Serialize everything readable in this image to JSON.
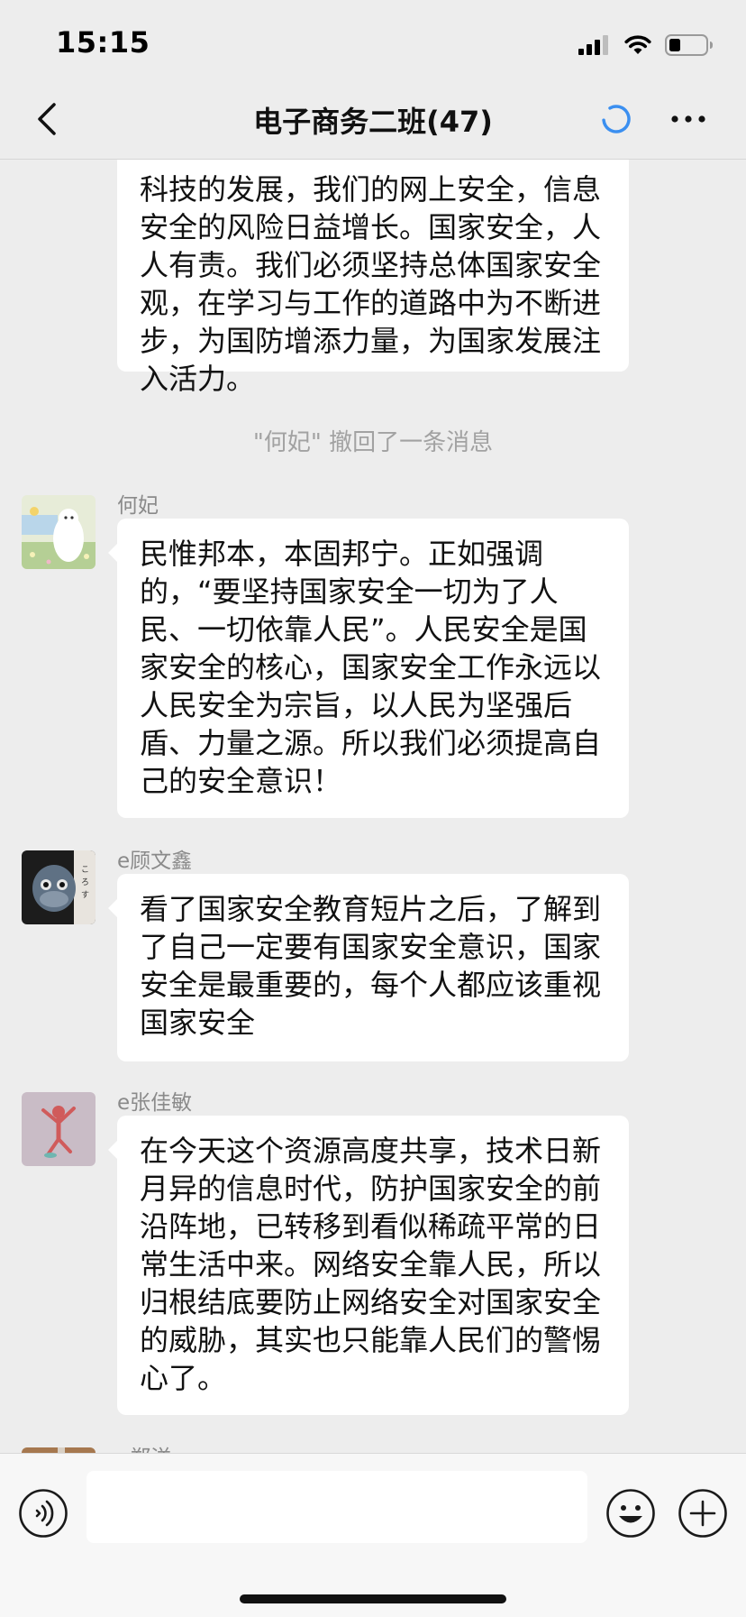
{
  "status_bar": {
    "time": "15:15"
  },
  "nav": {
    "title": "电子商务二班(47)"
  },
  "messages": [
    {
      "text": "科技的发展，我们的网上安全，信息安全的风险日益增长。国家安全，人人有责。我们必须坚持总体国家安全观，在学习与工作的道路中为不断进步，为国防增添力量，为国家发展注入活力。"
    },
    {
      "sender": "何妃",
      "text": "民惟邦本，本固邦宁。正如强调的，“要坚持国家安全一切为了人民、一切依靠人民”。人民安全是国家安全的核心，国家安全工作永远以人民安全为宗旨，以人民为坚强后盾、力量之源。所以我们必须提高自己的安全意识！"
    },
    {
      "sender": "e顾文鑫",
      "text": "看了国家安全教育短片之后，了解到了自己一定要有国家安全意识，国家安全是最重要的，每个人都应该重视国家安全"
    },
    {
      "sender": "e张佳敏",
      "text": "在今天这个资源高度共享，技术日新月异的信息时代，防护国家安全的前沿阵地，已转移到看似稀疏平常的日常生活中来。网络安全靠人民，所以归根结底要防止网络安全对国家安全的威胁，其实也只能靠人民们的警惕心了。"
    },
    {
      "sender": "e郑洋"
    }
  ],
  "system": {
    "recall_notice": "\"何妃\" 撤回了一条消息"
  },
  "input": {
    "value": ""
  },
  "colors": {
    "background": "#ededed",
    "bubble": "#ffffff",
    "accent_loading": "#3b8ff0"
  }
}
